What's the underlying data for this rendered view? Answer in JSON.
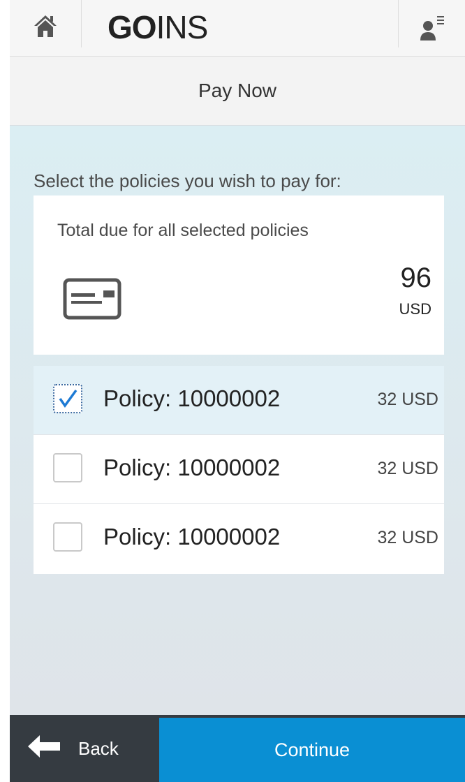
{
  "header": {
    "logo_bold": "GO",
    "logo_light": "INS"
  },
  "page_title": "Pay Now",
  "instruction": "Select the policies you wish to pay for:",
  "total": {
    "label": "Total due for all selected policies",
    "amount": "96",
    "currency": "USD"
  },
  "policies": [
    {
      "label": "Policy: 10000002",
      "amount": "32 USD",
      "checked": true
    },
    {
      "label": "Policy: 10000002",
      "amount": "32 USD",
      "checked": false
    },
    {
      "label": "Policy: 10000002",
      "amount": "32 USD",
      "checked": false
    }
  ],
  "footer": {
    "back_label": "Back",
    "continue_label": "Continue"
  },
  "colors": {
    "accent": "#0a8fd3",
    "footer_bg": "#353b41",
    "selected_row": "#e3f1f7"
  }
}
